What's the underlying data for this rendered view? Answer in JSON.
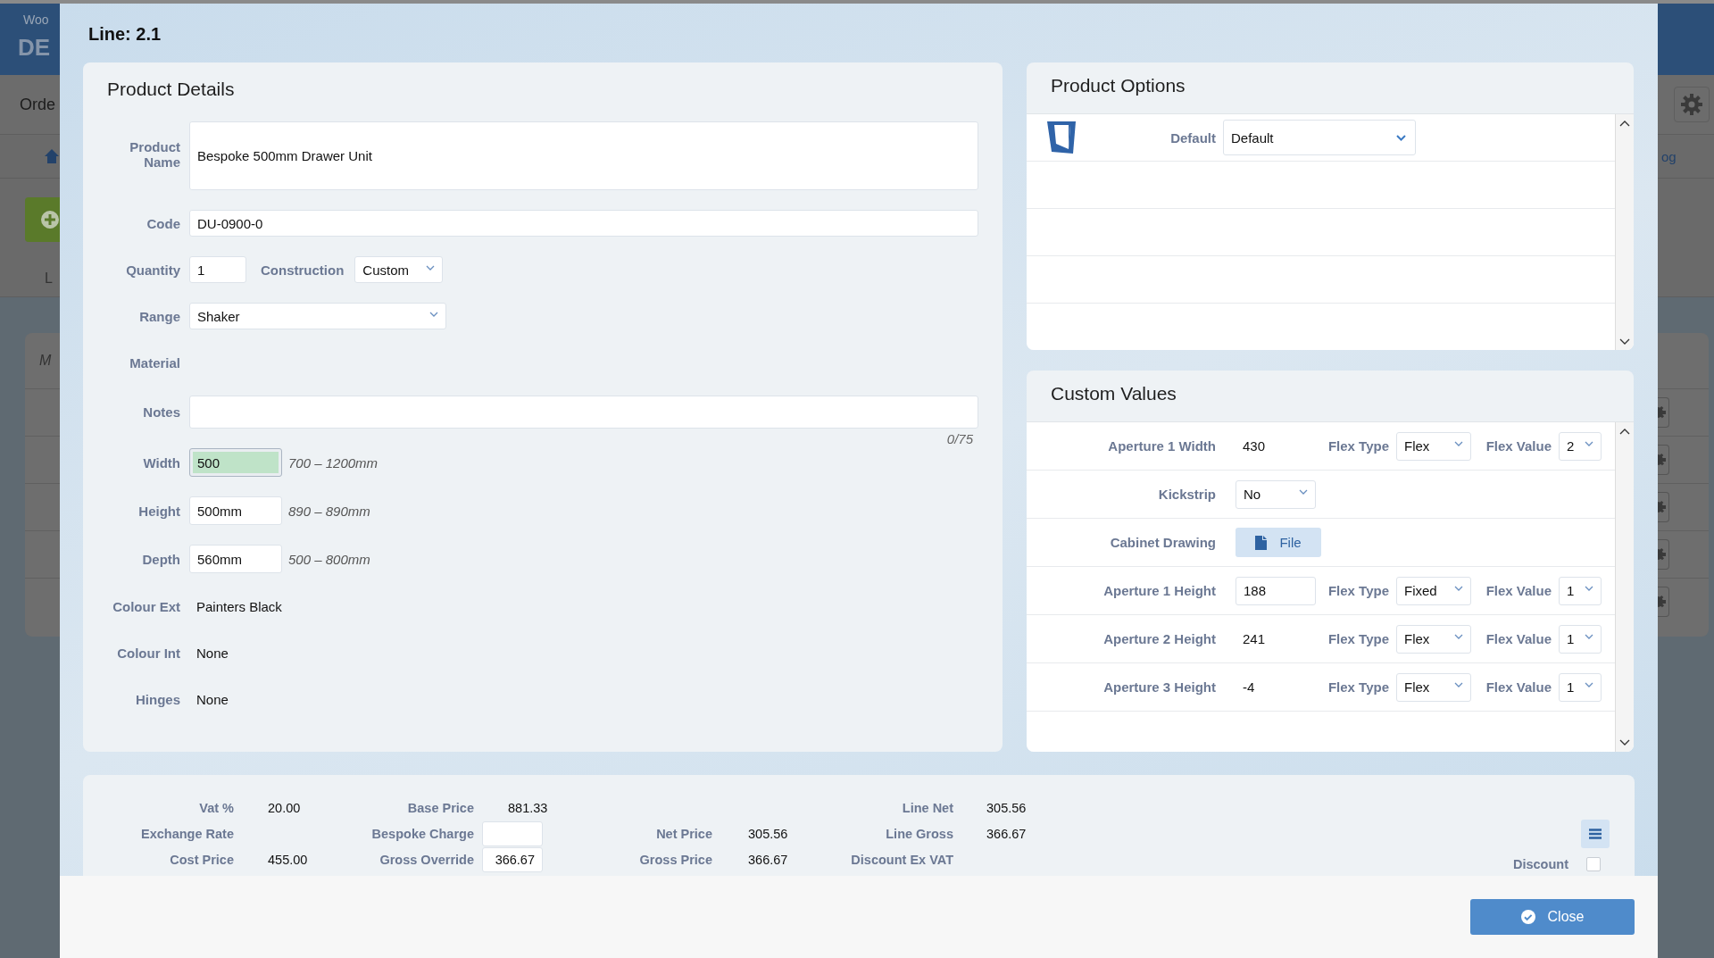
{
  "background_app": {
    "logo_text": "Woo",
    "app_title": "DE",
    "nav_text": "Orde",
    "section_text": "L",
    "column_heading": "M",
    "tab_text": "og"
  },
  "dialog": {
    "title": "Line: 2.1"
  },
  "product_details": {
    "title": "Product Details",
    "fields": [
      {
        "kind": "tall",
        "label": "Product Name",
        "value": "Bespoke 500mm Drawer Unit"
      },
      {
        "kind": "wide",
        "label": "Code",
        "value": "DU-0900-0"
      },
      {
        "kind": "pair",
        "label": "Quantity",
        "value": "1",
        "extra_label": "Construction",
        "extra_value": "Custom"
      },
      {
        "kind": "select",
        "label": "Range",
        "value": "Shaker"
      },
      {
        "kind": "empty",
        "label": "Material"
      },
      {
        "kind": "notes",
        "label": "Notes",
        "counter": "0/75"
      },
      {
        "kind": "dimension",
        "label": "Width",
        "value": "500",
        "range": "700 – 1200mm",
        "highlighted": true
      },
      {
        "kind": "dimension",
        "label": "Height",
        "value": "500mm",
        "range": "890 – 890mm",
        "highlighted": false
      },
      {
        "kind": "dimension",
        "label": "Depth",
        "value": "560mm",
        "range": "500 – 800mm",
        "highlighted": false
      },
      {
        "kind": "static",
        "label": "Colour Ext",
        "value": "Painters Black"
      },
      {
        "kind": "static",
        "label": "Colour Int",
        "value": "None"
      },
      {
        "kind": "static",
        "label": "Hinges",
        "value": "None"
      }
    ]
  },
  "product_options": {
    "title": "Product Options",
    "rows": [
      {
        "label": "Default",
        "value": "Default"
      }
    ]
  },
  "custom_values": {
    "title": "Custom Values",
    "rows": [
      {
        "kind": "plain",
        "label": "Aperture 1 Width",
        "value": "430",
        "flex_type_label": "Flex Type",
        "flex_type": "Flex",
        "flex_value_label": "Flex Value",
        "flex_value": "2"
      },
      {
        "kind": "select",
        "label": "Kickstrip",
        "value": "No"
      },
      {
        "kind": "file",
        "label": "Cabinet Drawing",
        "value": "File"
      },
      {
        "kind": "input",
        "label": "Aperture 1 Height",
        "value": "188",
        "flex_type_label": "Flex Type",
        "flex_type": "Fixed",
        "flex_value_label": "Flex Value",
        "flex_value": "1"
      },
      {
        "kind": "plain",
        "label": "Aperture 2 Height",
        "value": "241",
        "flex_type_label": "Flex Type",
        "flex_type": "Flex",
        "flex_value_label": "Flex Value",
        "flex_value": "1"
      },
      {
        "kind": "plain",
        "label": "Aperture 3 Height",
        "value": "-4",
        "flex_type_label": "Flex Type",
        "flex_type": "Flex",
        "flex_value_label": "Flex Value",
        "flex_value": "1"
      }
    ]
  },
  "pricing": {
    "columns": [
      {
        "items": [
          {
            "kind": "plain",
            "label": "Vat %",
            "value": "20.00"
          },
          {
            "kind": "plain",
            "label": "Exchange Rate"
          },
          {
            "kind": "plain",
            "label": "Cost Price",
            "value": "455.00"
          }
        ]
      },
      {
        "items": [
          {
            "kind": "plain",
            "label": "Base Price",
            "value": "881.33"
          },
          {
            "kind": "input",
            "label": "Bespoke Charge"
          },
          {
            "kind": "input",
            "label": "Gross Override",
            "value": "366.67"
          }
        ]
      },
      {
        "items": [
          {
            "kind": "plain",
            "label": "Net Price",
            "value": "305.56"
          },
          {
            "kind": "plain",
            "label": "Gross Price",
            "value": "366.67"
          }
        ]
      },
      {
        "items": [
          {
            "kind": "plain",
            "label": "Line Net",
            "value": "305.56"
          },
          {
            "kind": "plain",
            "label": "Line Gross",
            "value": "366.67"
          },
          {
            "kind": "plain",
            "label": "Discount Ex VAT"
          }
        ]
      }
    ],
    "discount": {
      "label": "Discount",
      "checked": false
    }
  },
  "footer": {
    "close_button": "Close"
  }
}
